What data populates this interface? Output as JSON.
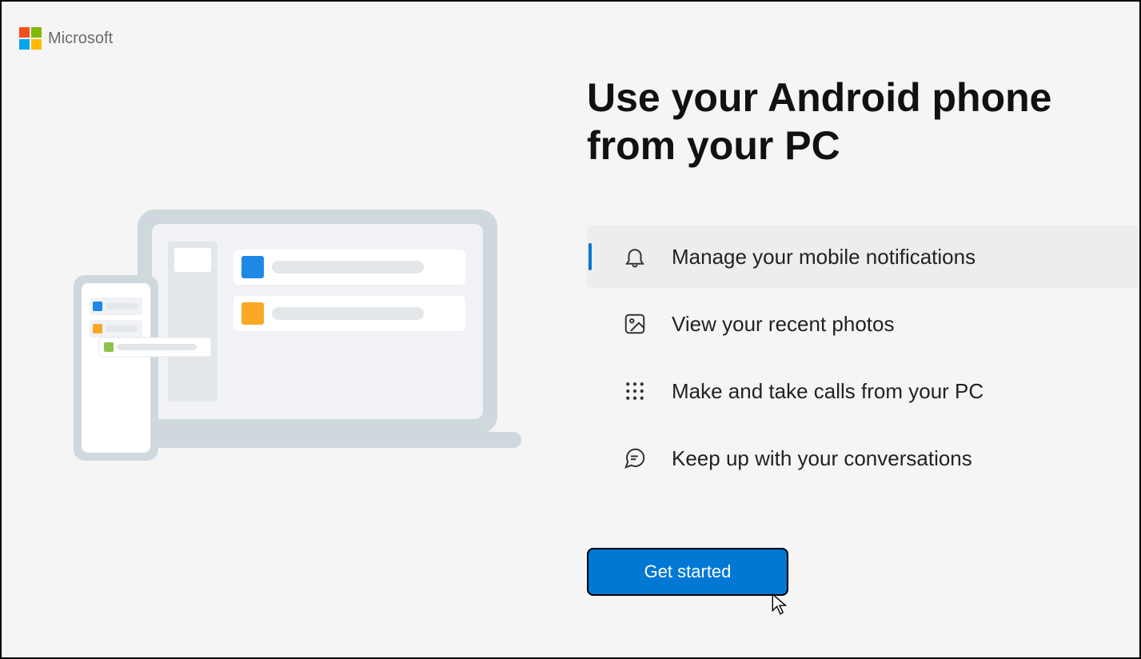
{
  "brand": {
    "name": "Microsoft"
  },
  "title": "Use your Android phone from your PC",
  "features": {
    "notifications": "Manage your mobile notifications",
    "photos": "View your recent photos",
    "calls": "Make and take calls from your PC",
    "conversations": "Keep up with your conversations"
  },
  "cta": {
    "label": "Get started"
  },
  "colors": {
    "ms_red": "#f25022",
    "ms_green": "#7fba00",
    "ms_blue": "#00a4ef",
    "ms_yellow": "#ffb900",
    "accent": "#0078d4"
  }
}
